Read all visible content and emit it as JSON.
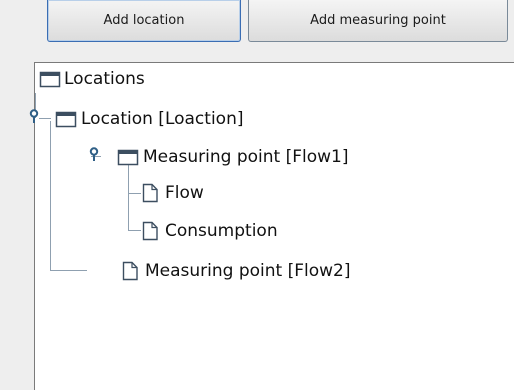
{
  "toolbar": {
    "add_location_label": "Add location",
    "add_measuring_point_label": "Add measuring point"
  },
  "tree": {
    "root": {
      "label": "Locations",
      "icon": "folder-icon"
    },
    "location": {
      "label": "Location [Loaction]",
      "icon": "folder-icon",
      "expanded": true
    },
    "measuring_point_1": {
      "label": "Measuring point [Flow1]",
      "icon": "folder-icon",
      "expanded": true
    },
    "flow": {
      "label": "Flow",
      "icon": "file-icon"
    },
    "consumption": {
      "label": "Consumption",
      "icon": "file-icon"
    },
    "measuring_point_2": {
      "label": "Measuring point [Flow2]",
      "icon": "file-icon"
    }
  },
  "colors": {
    "tree_line": "#8fa0b0",
    "icon_stroke": "#3c4e60",
    "handle": "#2f5f86",
    "selected_button_border": "#3a6db3"
  }
}
